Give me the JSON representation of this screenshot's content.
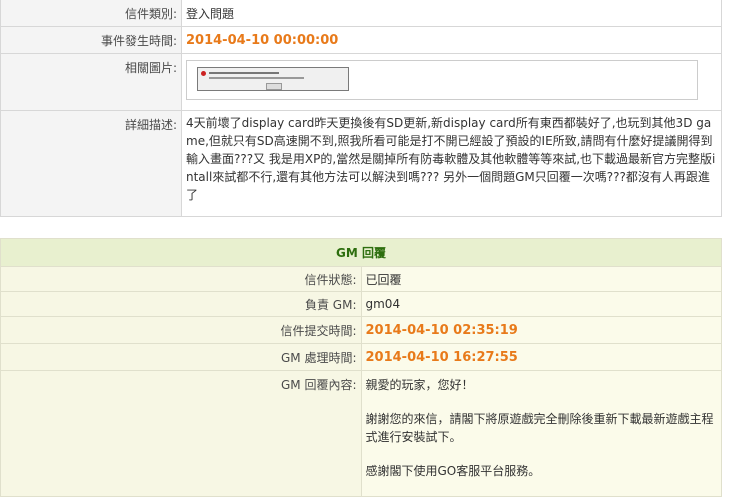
{
  "ticket": {
    "category_label": "信件類別:",
    "category_value": "登入問題",
    "event_time_label": "事件發生時間:",
    "event_time_value": "2014-04-10 00:00:00",
    "images_label": "相關圖片:",
    "description_label": "詳細描述:",
    "description_value": "4天前壞了display card昨天更換後有SD更新,新display card所有東西都裝好了,也玩到其他3D game,但就只有SD高速開不到,照我所看可能是打不開已經設了預設的IE所致,請問有什麼好提議開得到輸入畫面???又 我是用XP的,當然是關掉所有防毒軟體及其他軟體等等來試,也下載過最新官方完整版intall來試都不行,還有其他方法可以解決到嗎??? 另外一個問題GM只回覆一次嗎???都沒有人再跟進了"
  },
  "gm_reply": {
    "header": "GM 回覆",
    "status_label": "信件狀態:",
    "status_value": "已回覆",
    "gm_label": "負責 GM:",
    "gm_value": "gm04",
    "submit_time_label": "信件提交時間:",
    "submit_time_value": "2014-04-10 02:35:19",
    "process_time_label": "GM 處理時間:",
    "process_time_value": "2014-04-10 16:27:55",
    "content_label": "GM 回覆內容:",
    "content_greeting": "親愛的玩家，您好！",
    "content_body": "謝謝您的來信，請閣下將原遊戲完全刪除後重新下載最新遊戲主程式進行安裝試下。",
    "content_closing": "感謝閣下使用GO客服平台服務。"
  }
}
